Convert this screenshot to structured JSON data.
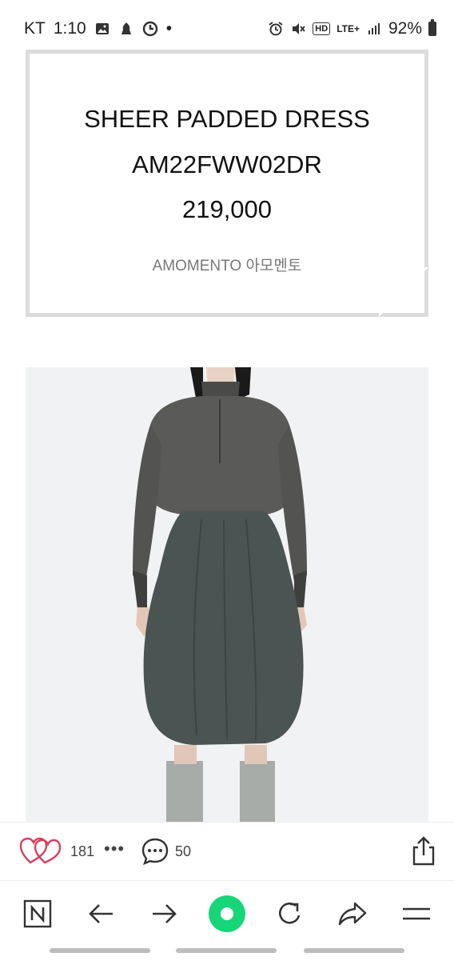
{
  "status_bar": {
    "carrier": "KT",
    "time": "1:10",
    "dot": "•",
    "network": "LTE+",
    "hd": "HD",
    "battery": "92%"
  },
  "product_card": {
    "name": "SHEER PADDED DRESS",
    "code": "AM22FWW02DR",
    "price": "219,000",
    "brand": "AMOMENTO 아모멘토"
  },
  "action_bar": {
    "likes": "181",
    "more": "•••",
    "comments": "50"
  },
  "colors": {
    "heart_pink": "#d6405f",
    "nav_green": "#17d67a",
    "card_border": "#dcdcdc"
  },
  "nav_bar": {
    "home_icon": "naver-n-icon",
    "back_icon": "arrow-left-icon",
    "forward_icon": "arrow-right-icon",
    "center_icon": "green-circle-icon",
    "refresh_icon": "refresh-icon",
    "share_icon": "share-arrow-icon",
    "menu_icon": "menu-icon"
  }
}
